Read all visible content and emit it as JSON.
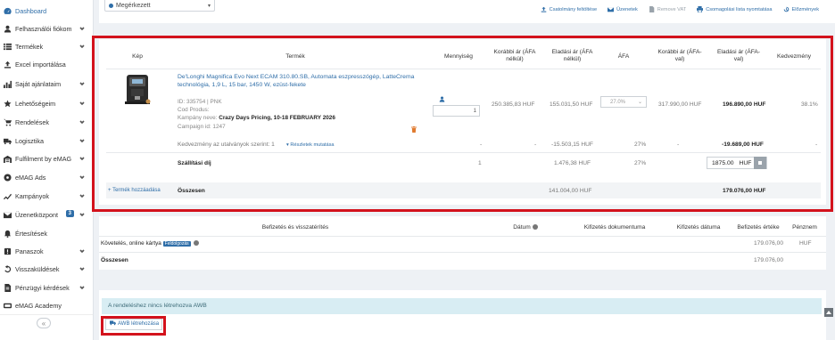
{
  "sidebar": {
    "items": [
      {
        "label": "Dashboard",
        "icon": "dashboard-icon",
        "chevron": false,
        "active": true
      },
      {
        "label": "Felhasználói fiókom",
        "icon": "user-icon",
        "chevron": true
      },
      {
        "label": "Termékek",
        "icon": "list-icon",
        "chevron": true
      },
      {
        "label": "Excel importálása",
        "icon": "upload-icon",
        "chevron": false
      },
      {
        "label": "Saját ajánlataim",
        "icon": "chart-icon",
        "chevron": true
      },
      {
        "label": "Lehetőségeim",
        "icon": "star-icon",
        "chevron": true
      },
      {
        "label": "Rendelések",
        "icon": "cart-icon",
        "chevron": true
      },
      {
        "label": "Logisztika",
        "icon": "truck-icon",
        "chevron": true
      },
      {
        "label": "Fulfilment by eMAG",
        "icon": "warehouse-icon",
        "chevron": true
      },
      {
        "label": "eMAG Ads",
        "icon": "ads-icon",
        "chevron": true
      },
      {
        "label": "Kampányok",
        "icon": "trend-icon",
        "chevron": true
      },
      {
        "label": "Üzenetközpont",
        "icon": "envelope-icon",
        "chevron": true,
        "badge": "3"
      },
      {
        "label": "Értesítések",
        "icon": "bell-icon",
        "chevron": false
      },
      {
        "label": "Panaszok",
        "icon": "warning-icon",
        "chevron": true
      },
      {
        "label": "Visszaküldések",
        "icon": "return-icon",
        "chevron": true
      },
      {
        "label": "Pénzügyi kérdések",
        "icon": "document-icon",
        "chevron": true
      },
      {
        "label": "eMAG Academy",
        "icon": "academy-icon",
        "chevron": false
      }
    ],
    "collapse_label": "«"
  },
  "topbar": {
    "status_value": "Megérkezett",
    "actions": [
      {
        "label": "Csatolmány feltöltése",
        "icon": "upload-icon",
        "disabled": false
      },
      {
        "label": "Üzenetek",
        "icon": "envelope-icon",
        "disabled": false
      },
      {
        "label": "Remove VAT",
        "icon": "document-icon",
        "disabled": true
      },
      {
        "label": "Csomagolási lista nyomtatása",
        "icon": "printer-icon",
        "disabled": false
      },
      {
        "label": "Előzmények",
        "icon": "history-icon",
        "disabled": false
      }
    ]
  },
  "products": {
    "headers": {
      "image": "Kép",
      "product": "Termék",
      "quantity": "Mennyiség",
      "prev_price_net": "Korábbi ár (ÁFA nélkül)",
      "sale_price_net": "Eladási ár (ÁFA nélkül)",
      "vat": "ÁFA",
      "prev_price_gross": "Korábbi ár (ÁFA-val)",
      "sale_price_gross": "Eladási ár (ÁFA-val)",
      "discount": "Kedvezmény"
    },
    "item": {
      "name": "De'Longhi Magnifica Evo Next ECAM 310.80.SB, Automata eszpresszógép, LatteCrema technológia, 1,9 L, 15 bar, 1450 W, ezüst-fekete",
      "id_line": "ID: 335754 | PNK",
      "cod_line": "Cod Produs:",
      "campaign_label": "Kampány neve:",
      "campaign_name": "Crazy Days Pricing, 10-18 FEBRUARY 2026",
      "campaign_id": "Campaign id: 1247",
      "quantity": "1",
      "prev_price_net": "250.385,83 HUF",
      "sale_price_net": "155.031,50 HUF",
      "vat": "27.0%",
      "prev_price_gross": "317.990,00 HUF",
      "sale_price_gross": "196.890,00 HUF",
      "discount": "38.1%"
    },
    "voucher": {
      "label": "Kedvezmény az utalványok szerint: 1",
      "link": "Részletek mutatása",
      "dash1": "-",
      "dash2": "-",
      "sale_net": "-15.503,15 HUF",
      "vat": "27%",
      "dash3": "-",
      "sale_gross": "-19.689,00 HUF",
      "dash4": "-"
    },
    "shipping": {
      "label": "Szállítási díj",
      "quantity": "1",
      "sale_net": "1.476,38 HUF",
      "vat": "27%",
      "sale_gross_input": "1875.00",
      "currency": "HUF"
    },
    "total": {
      "add_label": "Termék hozzáadása",
      "label": "Összesen",
      "net": "141.004,00 HUF",
      "gross": "179.076,00 HUF"
    }
  },
  "payments": {
    "headers": {
      "payment": "Befizetés és visszatérítés",
      "date": "Dátum",
      "doc": "Kifizetés dokumentuma",
      "pay_date": "Kifizetés dátuma",
      "value": "Befizetés értéke",
      "currency": "Pénznem"
    },
    "rows": [
      {
        "label": "Követelés, online kártya",
        "badge": "Feldolgozás",
        "value": "179.076,00",
        "currency": "HUF"
      }
    ],
    "total_label": "Összesen",
    "total_value": "179.076,00"
  },
  "awb": {
    "info": "A rendeléshez nincs létrehozva AWB",
    "button": "AWB létrehozása"
  },
  "colors": {
    "accent": "#2f6ea8",
    "highlight": "#d3121c",
    "info_bg": "#d8edf3"
  }
}
